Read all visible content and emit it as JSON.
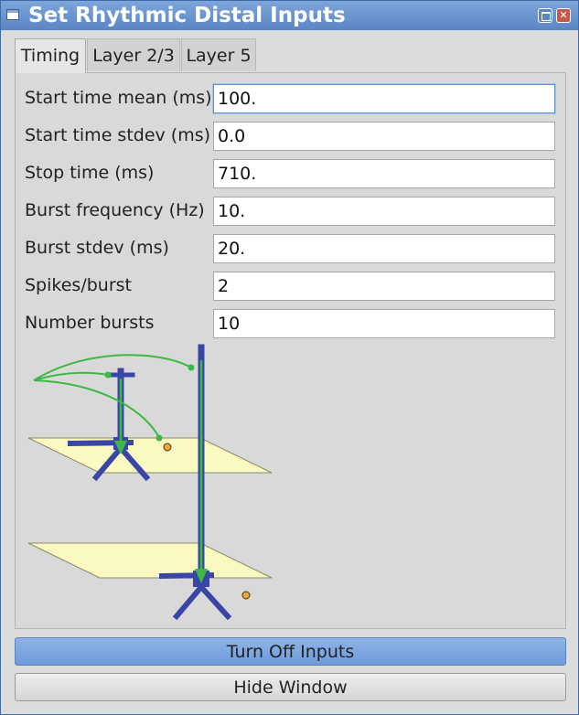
{
  "window": {
    "title": "Set Rhythmic Distal Inputs",
    "icon": "window-icon"
  },
  "titlebar_buttons": {
    "maximize": "maximize-icon",
    "close_glyph": "✕"
  },
  "tabs": [
    {
      "label": "Timing",
      "active": true
    },
    {
      "label": "Layer 2/3",
      "active": false
    },
    {
      "label": "Layer 5",
      "active": false
    }
  ],
  "fields": {
    "start_mean": {
      "label": "Start time mean (ms)",
      "value": "100."
    },
    "start_stdev": {
      "label": "Start time stdev (ms)",
      "value": "0.0"
    },
    "stop_time": {
      "label": "Stop time (ms)",
      "value": "710."
    },
    "burst_freq": {
      "label": "Burst frequency (Hz)",
      "value": "10."
    },
    "burst_stdev": {
      "label": "Burst stdev (ms)",
      "value": "20."
    },
    "spikes_burst": {
      "label": "Spikes/burst",
      "value": "2"
    },
    "num_bursts": {
      "label": "Number bursts",
      "value": "10"
    }
  },
  "colors": {
    "neuron": "#3a46a6",
    "axon": "#3cb843",
    "layer_plane": "#fbf9c2",
    "soma_marker": "#f4a52a",
    "accent_button": "#7ea6e0"
  },
  "buttons": {
    "turn_off": "Turn Off Inputs",
    "hide": "Hide Window"
  }
}
